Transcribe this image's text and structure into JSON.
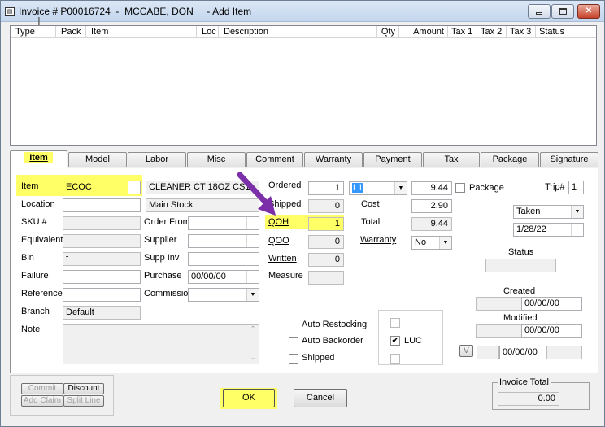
{
  "window": {
    "icon": "form-icon",
    "title": "Invoice # P00016724  -  MCCABE, DON     - Add Item",
    "minimize_label": "▭",
    "maximize_label": "□",
    "close_label": "✕"
  },
  "grid": {
    "columns": [
      "Type",
      "Pack",
      "Item",
      "Loc",
      "Description",
      "Qty",
      "Amount",
      "Tax 1",
      "Tax 2",
      "Tax 3",
      "Status"
    ]
  },
  "tabs": [
    "Item",
    "Model",
    "Labor",
    "Misc",
    "Comment",
    "Warranty",
    "Payment",
    "Tax",
    "Package",
    "Signature"
  ],
  "item_tab": {
    "left_labels": {
      "item": "Item",
      "location": "Location",
      "sku": "SKU #",
      "equivalent": "Equivalent",
      "bin": "Bin",
      "failure": "Failure",
      "reference": "Reference",
      "branch": "Branch",
      "note": "Note"
    },
    "item_value": "ECOC",
    "bin_value": "f",
    "branch_value": "Default",
    "description_value": "CLEANER CT 18OZ CS1",
    "location_desc": "Main Stock",
    "mid_labels": {
      "order_from": "Order From",
      "supplier": "Supplier",
      "supp_inv": "Supp Inv",
      "purchase": "Purchase",
      "commission": "Commission"
    },
    "purchase_value": "00/00/00",
    "qty_labels": {
      "ordered": "Ordered",
      "shipped": "Shipped",
      "qoh": "QOH",
      "qoo": "QOO",
      "written": "Written",
      "measure": "Measure"
    },
    "qty_values": {
      "ordered": "1",
      "shipped": "0",
      "qoh": "1",
      "qoo": "0",
      "written": "0"
    },
    "price_level": "L1",
    "price_value": "9.44",
    "package_label": "Package",
    "cost_label": "Cost",
    "cost_value": "2.90",
    "total_label": "Total",
    "total_value": "9.44",
    "warranty_label": "Warranty",
    "warranty_value": "No",
    "trip_label": "Trip#",
    "trip_value": "1",
    "taken_value": "Taken",
    "date_value": "1/28/22",
    "status_label": "Status",
    "created_label": "Created",
    "created_value": "00/00/00",
    "modified_label": "Modified",
    "modified_value": "00/00/00",
    "v_label": "V",
    "v_date": "00/00/00",
    "auto_restocking_label": "Auto Restocking",
    "auto_backorder_label": "Auto Backorder",
    "shipped_check_label": "Shipped",
    "luc_label": "LUC",
    "check_mark": "✔"
  },
  "footer": {
    "commit_label": "Commit",
    "discount_label": "Discount",
    "add_claim_label": "Add Claim",
    "split_line_label": "Split Line",
    "ok_label": "OK",
    "cancel_label": "Cancel",
    "invoice_total_label": "Invoice Total",
    "invoice_total_value": "0.00"
  },
  "colors": {
    "highlight": "#ffff66",
    "annotation_arrow": "#7b2fa8"
  }
}
